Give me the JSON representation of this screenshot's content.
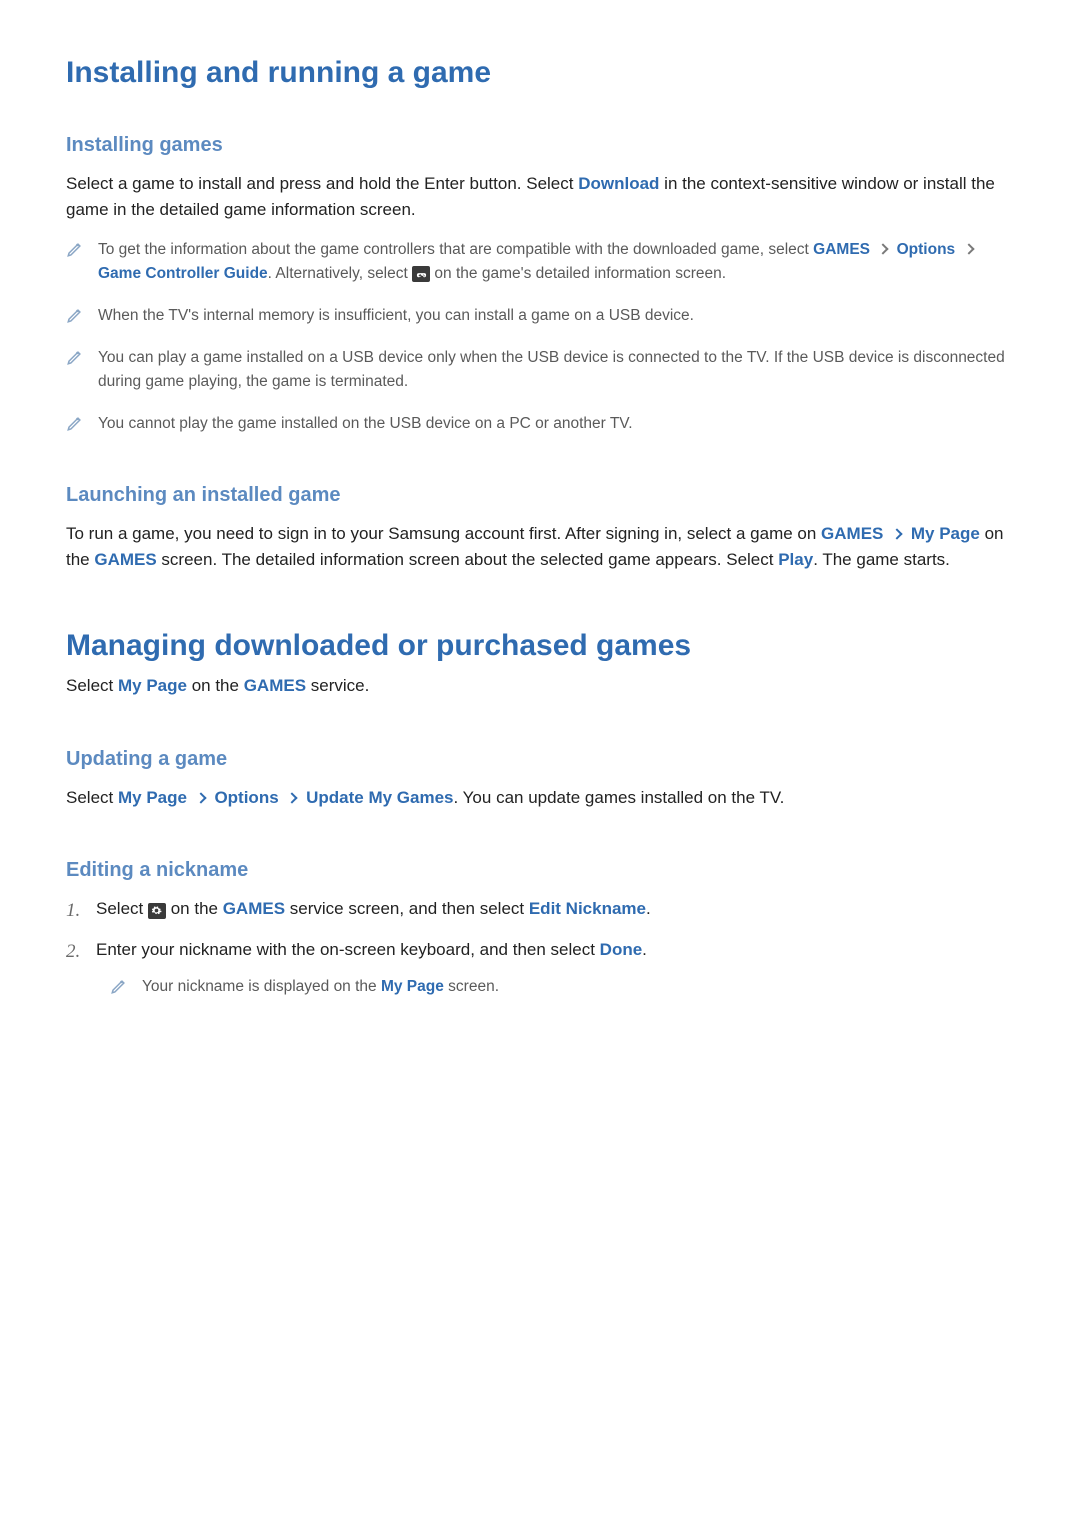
{
  "section1": {
    "title": "Installing and running a game",
    "sub1": {
      "heading": "Installing games",
      "para_a": "Select a game to install and press and hold the Enter button. Select ",
      "download": "Download",
      "para_b": " in the context-sensitive window or install the game in the detailed game information screen.",
      "notes": {
        "n1a": "To get the information about the game controllers that are compatible with the downloaded game, select ",
        "n1_games": "GAMES",
        "n1_options": "Options",
        "n1_guide": "Game Controller Guide",
        "n1b": ". Alternatively, select ",
        "n1c": " on the game's detailed information screen.",
        "n2": "When the TV's internal memory is insufficient, you can install a game on a USB device.",
        "n3": "You can play a game installed on a USB device only when the USB device is connected to the TV. If the USB device is disconnected during game playing, the game is terminated.",
        "n4": "You cannot play the game installed on the USB device on a PC or another TV."
      }
    },
    "sub2": {
      "heading": "Launching an installed game",
      "para_a": "To run a game, you need to sign in to your Samsung account first. After signing in, select a game on ",
      "games": "GAMES",
      "mypage": "My Page",
      "para_b": " on the ",
      "games2": "GAMES",
      "para_c": " screen. The detailed information screen about the selected game appears. Select ",
      "play": "Play",
      "para_d": ". The game starts."
    }
  },
  "section2": {
    "title": "Managing downloaded or purchased games",
    "intro_a": "Select ",
    "mypage": "My Page",
    "intro_b": " on the ",
    "games": "GAMES",
    "intro_c": " service.",
    "sub1": {
      "heading": "Updating a game",
      "para_a": "Select ",
      "mypage": "My Page",
      "options": "Options",
      "update": "Update My Games",
      "para_b": ". You can update games installed on the TV."
    },
    "sub2": {
      "heading": "Editing a nickname",
      "step1_a": "Select ",
      "step1_b": " on the ",
      "step1_games": "GAMES",
      "step1_c": " service screen, and then select ",
      "step1_edit": "Edit Nickname",
      "step2_a": "Enter your nickname with the on-screen keyboard, and then select ",
      "step2_done": "Done",
      "note_a": "Your nickname is displayed on the ",
      "note_mypage": "My Page",
      "note_b": " screen."
    }
  }
}
